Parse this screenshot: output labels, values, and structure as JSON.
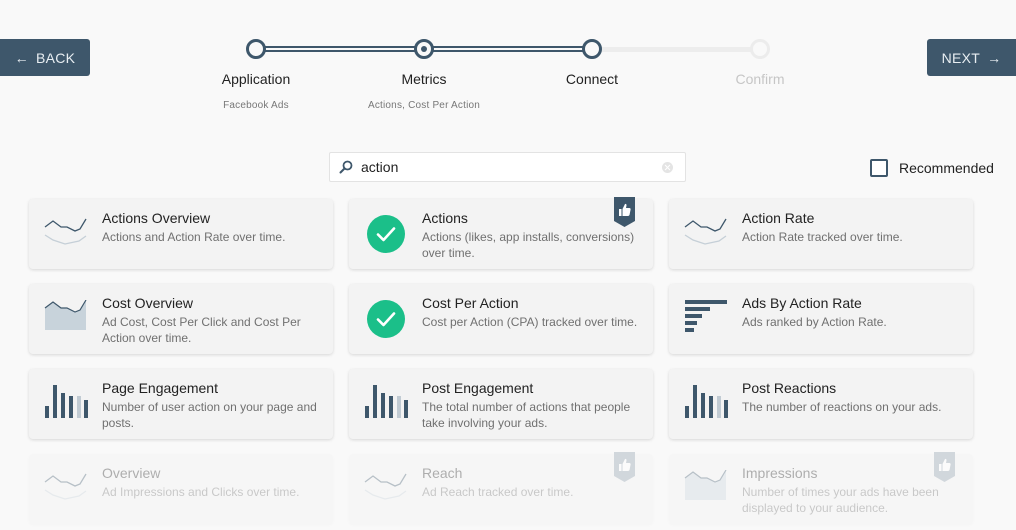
{
  "nav": {
    "back_label": "BACK",
    "next_label": "NEXT",
    "back_icon": "arrow-left-icon",
    "next_icon": "arrow-right-icon",
    "color": "#3e576b"
  },
  "stepper": {
    "steps": [
      {
        "label": "Application",
        "sub": "Facebook Ads",
        "state": "done"
      },
      {
        "label": "Metrics",
        "sub": "Actions, Cost Per Action",
        "state": "current"
      },
      {
        "label": "Connect",
        "sub": "",
        "state": "done"
      },
      {
        "label": "Confirm",
        "sub": "",
        "state": "todo"
      }
    ]
  },
  "search": {
    "value": "action",
    "icon": "search-icon",
    "clear_icon": "clear-icon"
  },
  "filter": {
    "recommended_label": "Recommended",
    "recommended_checked": false
  },
  "colors": {
    "accent": "#3e576b",
    "selected": "#1bbf89"
  },
  "cards": [
    {
      "title": "Actions Overview",
      "desc": "Actions and Action Rate over time.",
      "icon": "line-chart-icon",
      "selected": false,
      "recommended": false,
      "faded": false
    },
    {
      "title": "Actions",
      "desc": "Actions (likes, app installs, conversions) over time.",
      "icon": "check-circle-icon",
      "selected": true,
      "recommended": true,
      "faded": false
    },
    {
      "title": "Action Rate",
      "desc": "Action Rate tracked over time.",
      "icon": "line-chart-icon",
      "selected": false,
      "recommended": false,
      "faded": false
    },
    {
      "title": "Cost Overview",
      "desc": "Ad Cost, Cost Per Click and Cost Per Action over time.",
      "icon": "area-chart-icon",
      "selected": false,
      "recommended": false,
      "faded": false
    },
    {
      "title": "Cost Per Action",
      "desc": "Cost per Action (CPA) tracked over time.",
      "icon": "check-circle-icon",
      "selected": true,
      "recommended": false,
      "faded": false
    },
    {
      "title": "Ads By Action Rate",
      "desc": "Ads ranked by Action Rate.",
      "icon": "ranked-bars-icon",
      "selected": false,
      "recommended": false,
      "faded": false
    },
    {
      "title": "Page Engagement",
      "desc": "Number of user action on your page and posts.",
      "icon": "bar-chart-icon",
      "selected": false,
      "recommended": false,
      "faded": false
    },
    {
      "title": "Post Engagement",
      "desc": "The total number of actions that people take involving your ads.",
      "icon": "bar-chart-icon",
      "selected": false,
      "recommended": false,
      "faded": false
    },
    {
      "title": "Post Reactions",
      "desc": "The number of reactions on your ads.",
      "icon": "bar-chart-icon",
      "selected": false,
      "recommended": false,
      "faded": false
    },
    {
      "title": "Overview",
      "desc": "Ad Impressions and Clicks over time.",
      "icon": "line-chart-icon",
      "selected": false,
      "recommended": false,
      "faded": true
    },
    {
      "title": "Reach",
      "desc": "Ad Reach tracked over time.",
      "icon": "line-chart-icon",
      "selected": false,
      "recommended": true,
      "faded": true
    },
    {
      "title": "Impressions",
      "desc": "Number of times your ads have been displayed to your audience.",
      "icon": "area-chart-icon",
      "selected": false,
      "recommended": true,
      "faded": true
    }
  ]
}
